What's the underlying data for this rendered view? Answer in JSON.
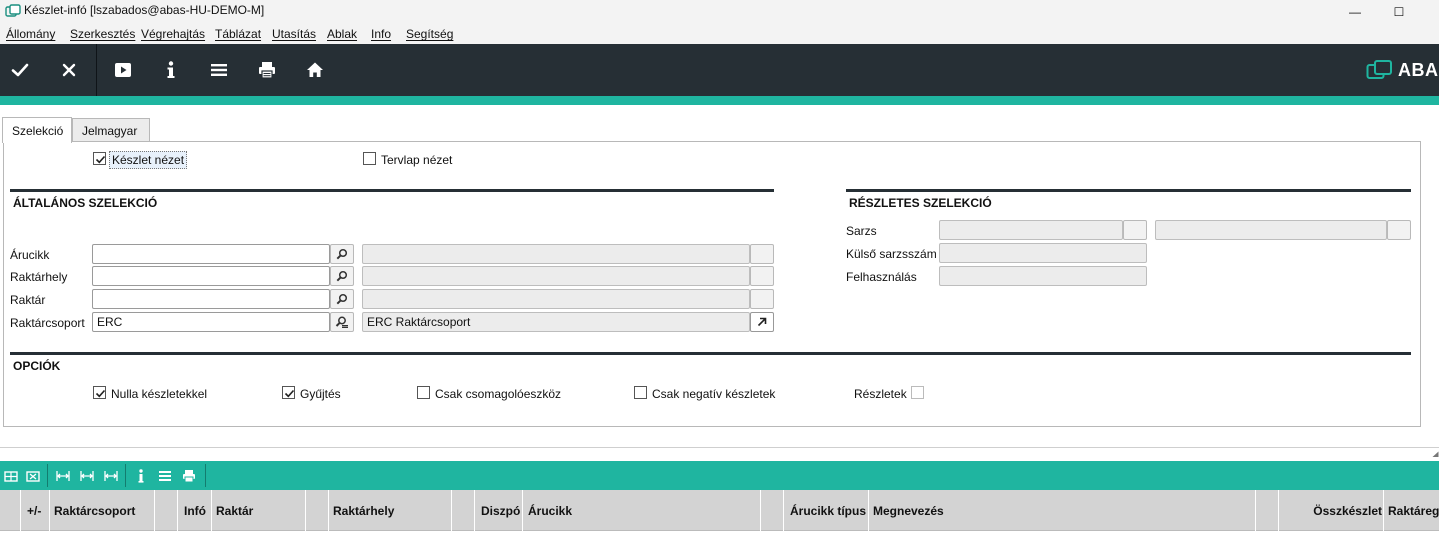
{
  "window": {
    "title": "Készlet-infó  [lszabados@abas-HU-DEMO-M]",
    "minimize": "—",
    "maximize": "☐"
  },
  "menu": [
    {
      "label": "Állomány"
    },
    {
      "label": "Szerkesztés"
    },
    {
      "label": "Végrehajtás"
    },
    {
      "label": "Táblázat"
    },
    {
      "label": "Utasítás"
    },
    {
      "label": "Ablak"
    },
    {
      "label": "Info"
    },
    {
      "label": "Segítség"
    }
  ],
  "toolbar": {
    "icons": [
      "check-icon",
      "close-icon",
      "play-icon",
      "info-icon",
      "menu-icon",
      "print-icon",
      "home-icon"
    ],
    "brand": "ABA"
  },
  "tabs": [
    {
      "label": "Szelekció",
      "active": true
    },
    {
      "label": "Jelmagyar",
      "active": false
    }
  ],
  "view": {
    "keszlet_nezet": {
      "label": "Készlet nézet",
      "checked": true
    },
    "tervlap_nezet": {
      "label": "Tervlap nézet",
      "checked": false
    }
  },
  "general": {
    "title": "ÁLTALÁNOS SZELEKCIÓ",
    "rows": [
      {
        "label": "Árucikk",
        "value": "",
        "desc": ""
      },
      {
        "label": "Raktárhely",
        "value": "",
        "desc": ""
      },
      {
        "label": "Raktár",
        "value": "",
        "desc": ""
      },
      {
        "label": "Raktárcsoport",
        "value": "ERC",
        "desc": "ERC Raktárcsoport"
      }
    ]
  },
  "detail": {
    "title": "RÉSZLETES SZELEKCIÓ",
    "rows": [
      {
        "label": "Sarzs",
        "value": "",
        "value2": ""
      },
      {
        "label": "Külső sarzsszám",
        "value": ""
      },
      {
        "label": "Felhasználás",
        "value": ""
      }
    ]
  },
  "options": {
    "title": "OPCIÓK",
    "items": [
      {
        "label": "Nulla készletekkel",
        "checked": true
      },
      {
        "label": "Gyűjtés",
        "checked": true
      },
      {
        "label": "Csak csomagolóeszköz",
        "checked": false
      },
      {
        "label": "Csak negatív készletek",
        "checked": false
      }
    ],
    "reszletek": {
      "label": "Részletek",
      "checked": false
    }
  },
  "grid": {
    "toolbar_icons": [
      "insert-row-icon",
      "delete-row-icon",
      "col-width-icon",
      "col-fit-icon",
      "col-reset-icon",
      "info-icon",
      "menu-icon",
      "print-icon"
    ],
    "columns": [
      "",
      "+/-",
      "Raktárcsoport",
      "",
      "Infó",
      "Raktár",
      "",
      "Raktárhely",
      "",
      "Diszpó",
      "Árucikk",
      "",
      "Árucikk típus",
      "Megnevezés",
      "",
      "Összkészlet",
      "Raktáreg"
    ]
  },
  "colors": {
    "toolbar_bg": "#262f35",
    "accent_teal": "#1fb5a0"
  }
}
